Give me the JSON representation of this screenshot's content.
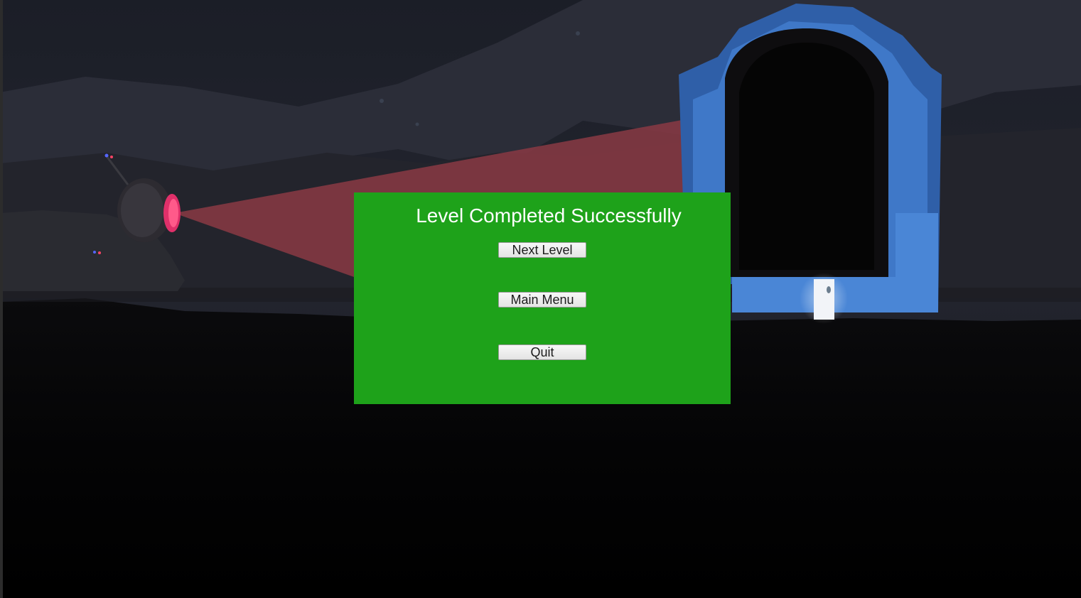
{
  "end_screen": {
    "title": "Level Completed Successfully",
    "buttons": {
      "next_level": "Next Level",
      "main_menu": "Main Menu",
      "quit": "Quit"
    }
  },
  "colors": {
    "panel": "#1ea21a",
    "panel_text": "#ffffff",
    "button_face": "#eeeeee",
    "sentry_light": "#e0306a",
    "portal_stone": "#3f78c8"
  },
  "scene": {
    "background_objects": [
      "sentry-robot",
      "detection-cone",
      "stone-portal",
      "white-door",
      "mountains",
      "stars"
    ]
  }
}
